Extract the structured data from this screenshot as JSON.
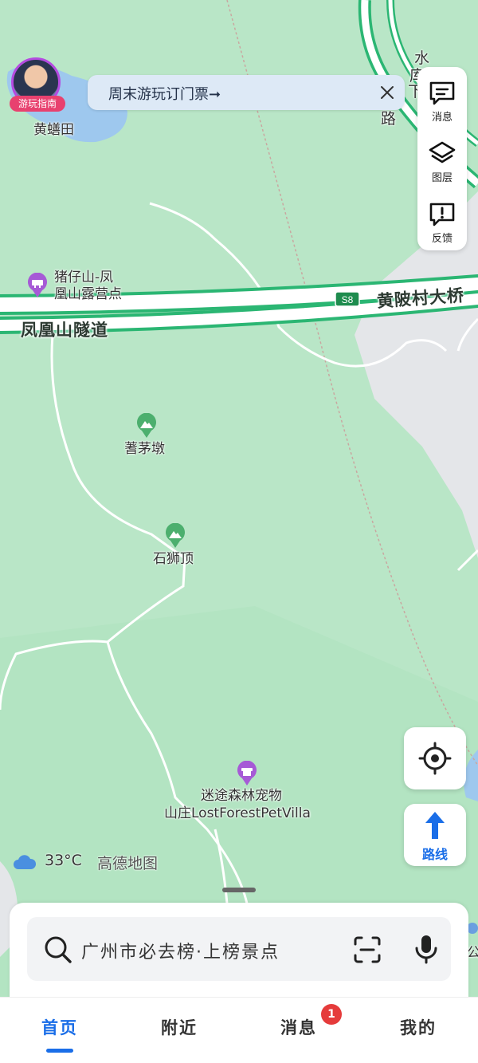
{
  "banner": {
    "text": "周末游玩订门票➞"
  },
  "guide_badge": "游玩指南",
  "side_panel": [
    {
      "label": "消息",
      "icon": "message-icon"
    },
    {
      "label": "图层",
      "icon": "layers-icon"
    },
    {
      "label": "反馈",
      "icon": "feedback-icon"
    }
  ],
  "map": {
    "places": {
      "huangshantian": "黄蟮田",
      "camp_line1": "猪仔山-凤",
      "camp_line2": "凰山露营点",
      "shimaodun": "蓍茅墩",
      "shishiding": "石狮顶",
      "villa_line1": "迷途森林宠物",
      "villa_line2": "山庄LostForestPetVilla"
    },
    "roads": {
      "tunnel": "凤凰山隧道",
      "bridge": "黄陂村大桥",
      "highway_shield": "S8",
      "side_road_chars": [
        "水",
        "库",
        "下",
        "路"
      ]
    },
    "edge_char": "公"
  },
  "weather": {
    "temp": "33°C",
    "brand": "高德地图"
  },
  "route_button": {
    "label": "路线"
  },
  "search": {
    "placeholder": "广州市必去榜·上榜景点"
  },
  "tabs": [
    {
      "label": "首页",
      "active": true
    },
    {
      "label": "附近",
      "active": false
    },
    {
      "label": "消息",
      "active": false,
      "badge": "1"
    },
    {
      "label": "我的",
      "active": false
    }
  ],
  "colors": {
    "map_green": "#b9e6c7",
    "road_green": "#2bb673",
    "accent_blue": "#1a6ee8",
    "badge_red": "#e53b3b",
    "camp_purple": "#a65ad6",
    "mountain_green": "#4caf6e"
  }
}
